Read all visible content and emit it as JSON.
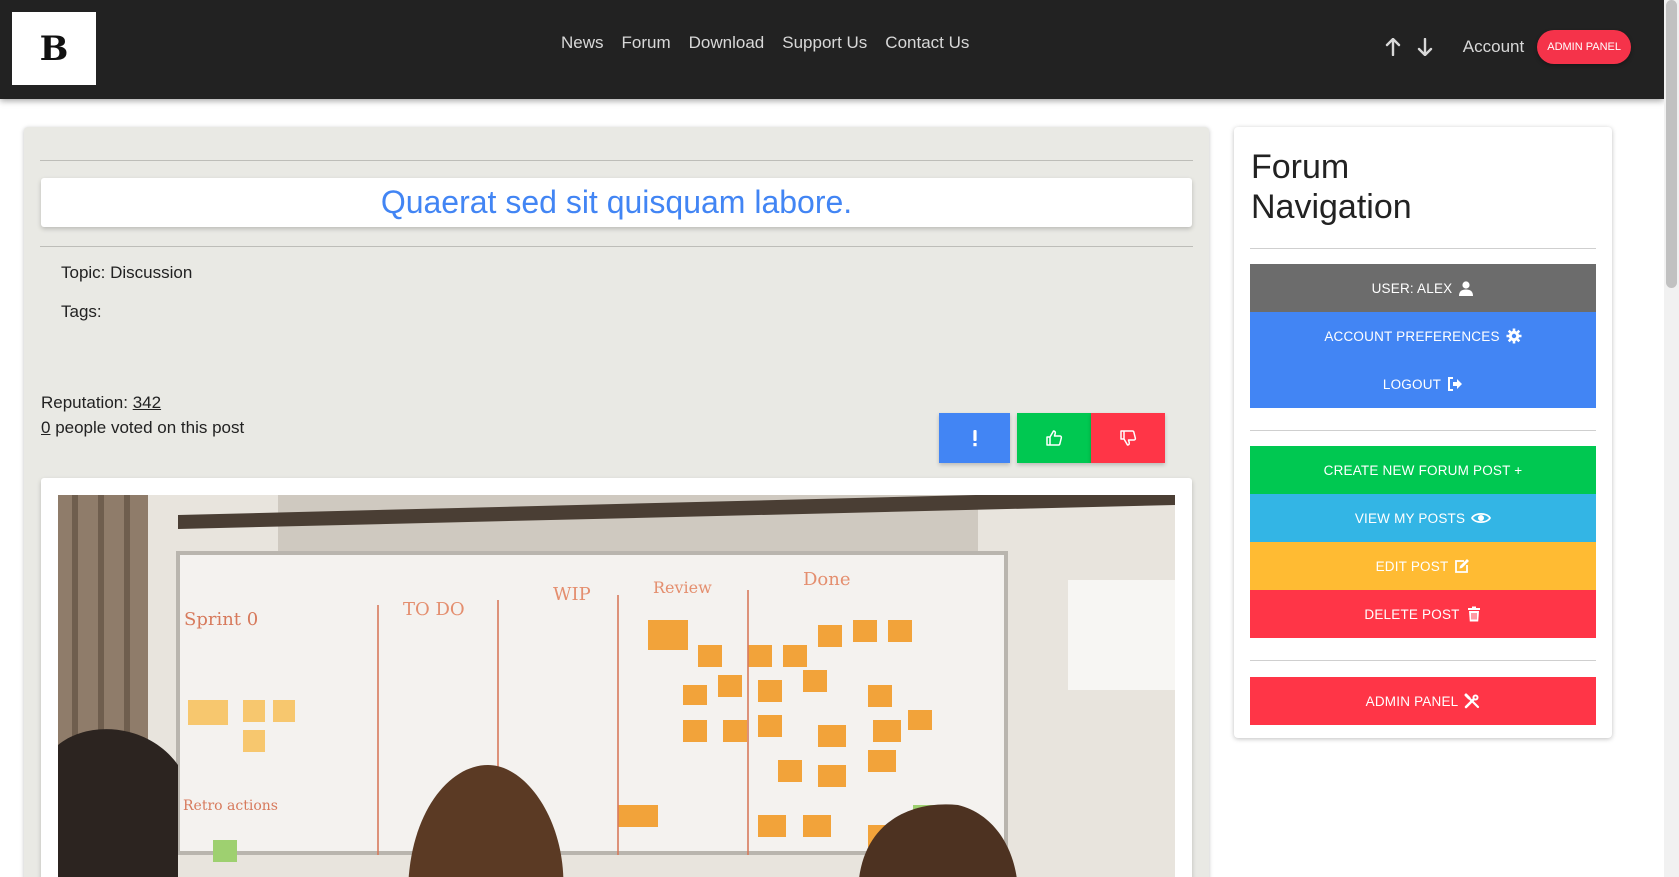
{
  "navbar": {
    "logo_text": "B",
    "links": [
      "News",
      "Forum",
      "Download",
      "Support Us",
      "Contact Us"
    ],
    "account_label": "Account",
    "admin_label": "ADMIN PANEL"
  },
  "post": {
    "title": "Quaerat sed sit quisquam labore.",
    "topic_label": "Topic: Discussion",
    "tags_label": "Tags:",
    "reputation_label": "Reputation: ",
    "reputation_value": "342",
    "votes_count": "0",
    "votes_suffix": " people voted on this post"
  },
  "sidebar": {
    "title": "Forum Navigation",
    "user_label": "USER: ALEX",
    "preferences_label": "ACCOUNT PREFERENCES",
    "logout_label": "LOGOUT",
    "create_label": "CREATE NEW FORUM POST +",
    "view_label": "VIEW MY POSTS",
    "edit_label": "EDIT POST",
    "delete_label": "DELETE POST",
    "admin_label": "ADMIN PANEL"
  },
  "colors": {
    "navbar_bg": "#222222",
    "accent_blue": "#4285f4",
    "success_green": "#00c851",
    "danger_red": "#ff3547",
    "info_cyan": "#33b5e5",
    "warning_amber": "#ffbb33",
    "user_gray": "#6c6c6c"
  },
  "icons": [
    "up-arrow-icon",
    "down-arrow-icon",
    "exclamation-icon",
    "thumbs-up-icon",
    "thumbs-down-icon",
    "user-icon",
    "gear-icon",
    "sign-out-icon",
    "eye-icon",
    "edit-icon",
    "trash-icon",
    "tools-icon"
  ]
}
